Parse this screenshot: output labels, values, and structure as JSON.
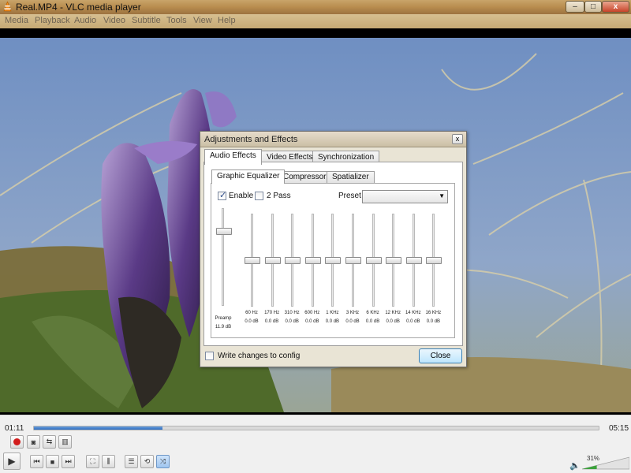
{
  "window": {
    "title": "Real.MP4 - VLC media player",
    "minimize": "–",
    "maximize": "□",
    "close": "x"
  },
  "menu": [
    "Media",
    "Playback",
    "Audio",
    "Video",
    "Subtitle",
    "Tools",
    "View",
    "Help"
  ],
  "dialog": {
    "title": "Adjustments and Effects",
    "close_x": "x",
    "tabs": [
      "Audio Effects",
      "Video Effects",
      "Synchronization"
    ],
    "subtabs": [
      "Graphic Equalizer",
      "Compressor",
      "Spatializer"
    ],
    "enable_label": "Enable",
    "enable_checked": true,
    "two_pass_label": "2 Pass",
    "two_pass_checked": false,
    "preset_label": "Preset",
    "preset_value": "",
    "preamp": {
      "label": "Preamp",
      "value": "11.9 dB",
      "level": 0.77
    },
    "bands": [
      {
        "freq": "60 Hz",
        "value": "0.0 dB"
      },
      {
        "freq": "170 Hz",
        "value": "0.0 dB"
      },
      {
        "freq": "310 Hz",
        "value": "0.0 dB"
      },
      {
        "freq": "600 Hz",
        "value": "0.0 dB"
      },
      {
        "freq": "1 KHz",
        "value": "0.0 dB"
      },
      {
        "freq": "3 KHz",
        "value": "0.0 dB"
      },
      {
        "freq": "6 KHz",
        "value": "0.0 dB"
      },
      {
        "freq": "12 KHz",
        "value": "0.0 dB"
      },
      {
        "freq": "14 KHz",
        "value": "0.0 dB"
      },
      {
        "freq": "16 KHz",
        "value": "0.0 dB"
      }
    ],
    "write_changes_label": "Write changes to config",
    "close_button": "Close"
  },
  "playback": {
    "elapsed": "01:11",
    "total": "05:15",
    "progress": 0.227
  },
  "volume": {
    "percent": "31%",
    "level": 0.31
  }
}
